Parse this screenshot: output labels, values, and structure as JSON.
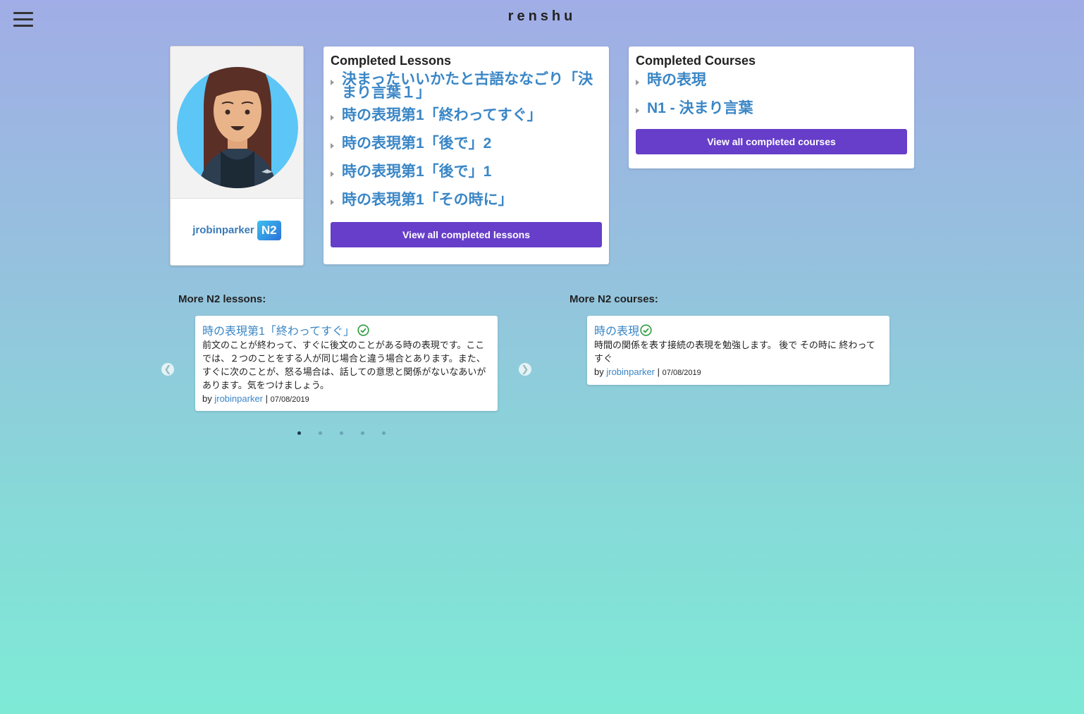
{
  "header": {
    "brand": "renshu",
    "menu_icon": "hamburger-icon"
  },
  "profile": {
    "username": "jrobinparker",
    "level": "N2"
  },
  "completed_lessons": {
    "title": "Completed Lessons",
    "items": [
      "決まったいいかたと古語ななごり「決まり言葉１」",
      "時の表現第1「終わってすぐ」",
      "時の表現第1「後で」2",
      "時の表現第1「後で」1",
      "時の表現第1「その時に」"
    ],
    "button": "View all completed lessons"
  },
  "completed_courses": {
    "title": "Completed Courses",
    "items": [
      "時の表現",
      "N1 - 決まり言葉"
    ],
    "button": "View all completed courses"
  },
  "more_lessons": {
    "label": "More N2 lessons:",
    "card": {
      "title": "時の表現第1「終わってすぐ」",
      "description": "前文のことが終わって、すぐに後文のことがある時の表現です。ここでは、２つのことをする人が同じ場合と違う場合とあります。また、すぐに次のことが、怒る場合は、話しての意思と関係がないなあいがあります。気をつけましょう。",
      "by": "by",
      "author": "jrobinparker",
      "separator": "|",
      "date": "07/08/2019"
    },
    "prev_icon": "chevron-left-icon",
    "next_icon": "chevron-right-icon",
    "dots": [
      true,
      false,
      false,
      false,
      false
    ]
  },
  "more_courses": {
    "label": "More N2 courses:",
    "card": {
      "title": "時の表現",
      "description": "時間の関係を表す接続の表現を勉強します。 後で その時に 終わってすぐ",
      "by": "by",
      "author": "jrobinparker",
      "separator": "|",
      "date": "07/08/2019"
    }
  },
  "colors": {
    "accent": "#663ec9",
    "link": "#3a86c6",
    "check": "#2e9c3e"
  }
}
